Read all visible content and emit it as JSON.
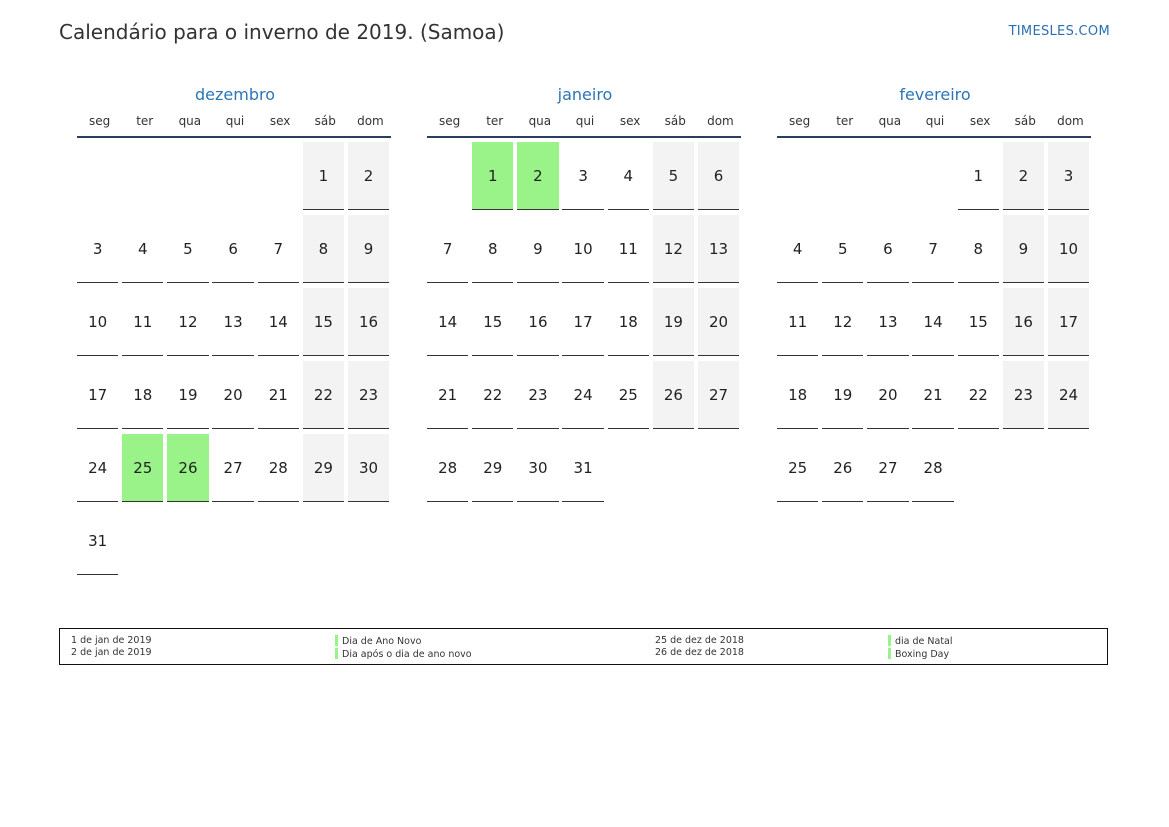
{
  "title": "Calendário para o inverno de 2019. (Samoa)",
  "brand": "TIMESLES.COM",
  "weekdays": [
    "seg",
    "ter",
    "qua",
    "qui",
    "sex",
    "sáb",
    "dom"
  ],
  "colors": {
    "holiday": "#99f389",
    "weekend": "#f3f3f3",
    "accent": "#2b74b8"
  },
  "months": [
    {
      "name": "dezembro",
      "weeks": [
        [
          "",
          "",
          "",
          "",
          "",
          "1",
          "2"
        ],
        [
          "3",
          "4",
          "5",
          "6",
          "7",
          "8",
          "9"
        ],
        [
          "10",
          "11",
          "12",
          "13",
          "14",
          "15",
          "16"
        ],
        [
          "17",
          "18",
          "19",
          "20",
          "21",
          "22",
          "23"
        ],
        [
          "24",
          "25",
          "26",
          "27",
          "28",
          "29",
          "30"
        ],
        [
          "31",
          "",
          "",
          "",
          "",
          "",
          ""
        ]
      ],
      "holidays": [
        "25",
        "26"
      ]
    },
    {
      "name": "janeiro",
      "weeks": [
        [
          "",
          "1",
          "2",
          "3",
          "4",
          "5",
          "6"
        ],
        [
          "7",
          "8",
          "9",
          "10",
          "11",
          "12",
          "13"
        ],
        [
          "14",
          "15",
          "16",
          "17",
          "18",
          "19",
          "20"
        ],
        [
          "21",
          "22",
          "23",
          "24",
          "25",
          "26",
          "27"
        ],
        [
          "28",
          "29",
          "30",
          "31",
          "",
          "",
          ""
        ]
      ],
      "holidays": [
        "1",
        "2"
      ]
    },
    {
      "name": "fevereiro",
      "weeks": [
        [
          "",
          "",
          "",
          "",
          "1",
          "2",
          "3"
        ],
        [
          "4",
          "5",
          "6",
          "7",
          "8",
          "9",
          "10"
        ],
        [
          "11",
          "12",
          "13",
          "14",
          "15",
          "16",
          "17"
        ],
        [
          "18",
          "19",
          "20",
          "21",
          "22",
          "23",
          "24"
        ],
        [
          "25",
          "26",
          "27",
          "28",
          "",
          "",
          ""
        ]
      ],
      "holidays": []
    }
  ],
  "legend": {
    "left": [
      {
        "date": "1 de jan de 2019",
        "name": "Dia de Ano Novo"
      },
      {
        "date": "2 de jan de 2019",
        "name": "Dia após o dia de ano novo"
      }
    ],
    "right": [
      {
        "date": "25 de dez de 2018",
        "name": "dia de Natal"
      },
      {
        "date": "26 de dez de 2018",
        "name": "Boxing Day"
      }
    ]
  }
}
